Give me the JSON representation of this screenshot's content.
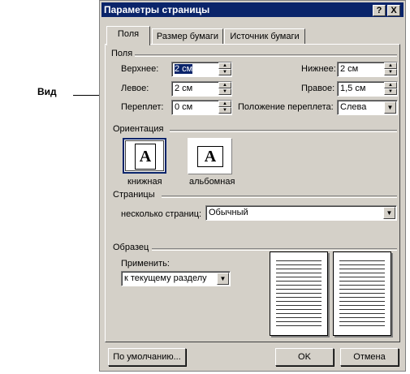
{
  "annotation": {
    "label": "Вид"
  },
  "dialog": {
    "title": "Параметры страницы",
    "help_button": "?",
    "close_button": "X",
    "tabs": [
      {
        "label": "Поля",
        "active": true
      },
      {
        "label": "Размер бумаги",
        "active": false
      },
      {
        "label": "Источник бумаги",
        "active": false
      }
    ],
    "margins": {
      "group_title": "Поля",
      "top": {
        "label": "Верхнее:",
        "value": "2 см"
      },
      "bottom": {
        "label": "Нижнее:",
        "value": "2 см"
      },
      "left": {
        "label": "Левое:",
        "value": "2 см"
      },
      "right": {
        "label": "Правое:",
        "value": "1,5 см"
      },
      "gutter": {
        "label": "Переплет:",
        "value": "0 см"
      },
      "gutter_position": {
        "label": "Положение переплета:",
        "value": "Слева"
      }
    },
    "orientation": {
      "group_title": "Ориентация",
      "portrait": {
        "label": "книжная",
        "glyph": "A",
        "selected": true
      },
      "landscape": {
        "label": "альбомная",
        "glyph": "A",
        "selected": false
      }
    },
    "pages": {
      "group_title": "Страницы",
      "multiple_label": "несколько страниц:",
      "multiple_value": "Обычный"
    },
    "preview": {
      "group_title": "Образец",
      "apply_label": "Применить:",
      "apply_value": "к текущему разделу"
    },
    "buttons": {
      "default": "По умолчанию...",
      "ok": "OK",
      "cancel": "Отмена"
    }
  },
  "colors": {
    "titlebar": "#0a246a",
    "face": "#d4d0c8"
  },
  "icons": {
    "spin_up": "▲",
    "spin_down": "▼",
    "dropdown": "▼"
  }
}
